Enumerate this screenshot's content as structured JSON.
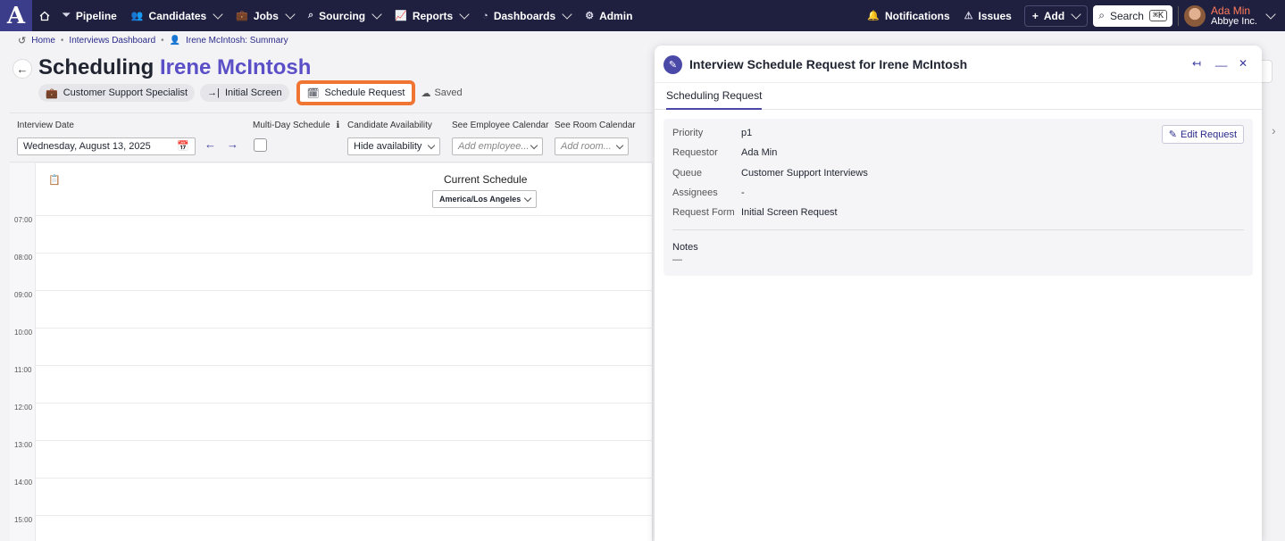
{
  "nav": {
    "logo": "A",
    "items": [
      {
        "label": "Pipeline",
        "icon": "filter-icon",
        "dropdown": false
      },
      {
        "label": "Candidates",
        "icon": "people-icon",
        "dropdown": true
      },
      {
        "label": "Jobs",
        "icon": "briefcase-icon",
        "dropdown": true
      },
      {
        "label": "Sourcing",
        "icon": "binoculars-icon",
        "dropdown": true
      },
      {
        "label": "Reports",
        "icon": "chart-icon",
        "dropdown": true
      },
      {
        "label": "Dashboards",
        "icon": "gauge-icon",
        "dropdown": true
      },
      {
        "label": "Admin",
        "icon": "gear-icon",
        "dropdown": false
      }
    ],
    "notifications": "Notifications",
    "issues": "Issues",
    "add": "Add",
    "search": "Search",
    "search_shortcut": "⌘K",
    "user_name": "Ada Min",
    "user_org": "Abbye Inc."
  },
  "breadcrumb": {
    "home": "Home",
    "dashboard": "Interviews Dashboard",
    "summary": "Irene McIntosh: Summary"
  },
  "header": {
    "title_prefix": "Scheduling",
    "candidate": "Irene McIntosh",
    "job_chip": "Customer Support Specialist",
    "stage_chip": "Initial Screen",
    "request_chip": "Schedule Request",
    "saved": "Saved"
  },
  "filters": {
    "date_label": "Interview Date",
    "date_value": "Wednesday, August 13, 2025",
    "multiday_label": "Multi-Day Schedule",
    "availability_label": "Candidate Availability",
    "availability_value": "Hide availability",
    "employee_label": "See Employee Calendar",
    "employee_placeholder": "Add employee...",
    "room_label": "See Room Calendar",
    "room_placeholder": "Add room..."
  },
  "calendar": {
    "title": "Current Schedule",
    "timezone": "America/Los Angeles",
    "hours": [
      "07:00",
      "08:00",
      "09:00",
      "10:00",
      "11:00",
      "12:00",
      "13:00",
      "14:00",
      "15:00"
    ]
  },
  "panel": {
    "title": "Interview Schedule Request for Irene McIntosh",
    "tab": "Scheduling Request",
    "edit": "Edit Request",
    "fields": [
      {
        "key": "Priority",
        "value": "p1"
      },
      {
        "key": "Requestor",
        "value": "Ada Min"
      },
      {
        "key": "Queue",
        "value": "Customer Support Interviews"
      },
      {
        "key": "Assignees",
        "value": "-"
      },
      {
        "key": "Request Form",
        "value": "Initial Screen Request"
      }
    ],
    "notes_label": "Notes",
    "notes_value": "—"
  },
  "colors": {
    "nav_bg": "#1f2040",
    "accent": "#5b4fc8",
    "highlight": "#f07432"
  }
}
